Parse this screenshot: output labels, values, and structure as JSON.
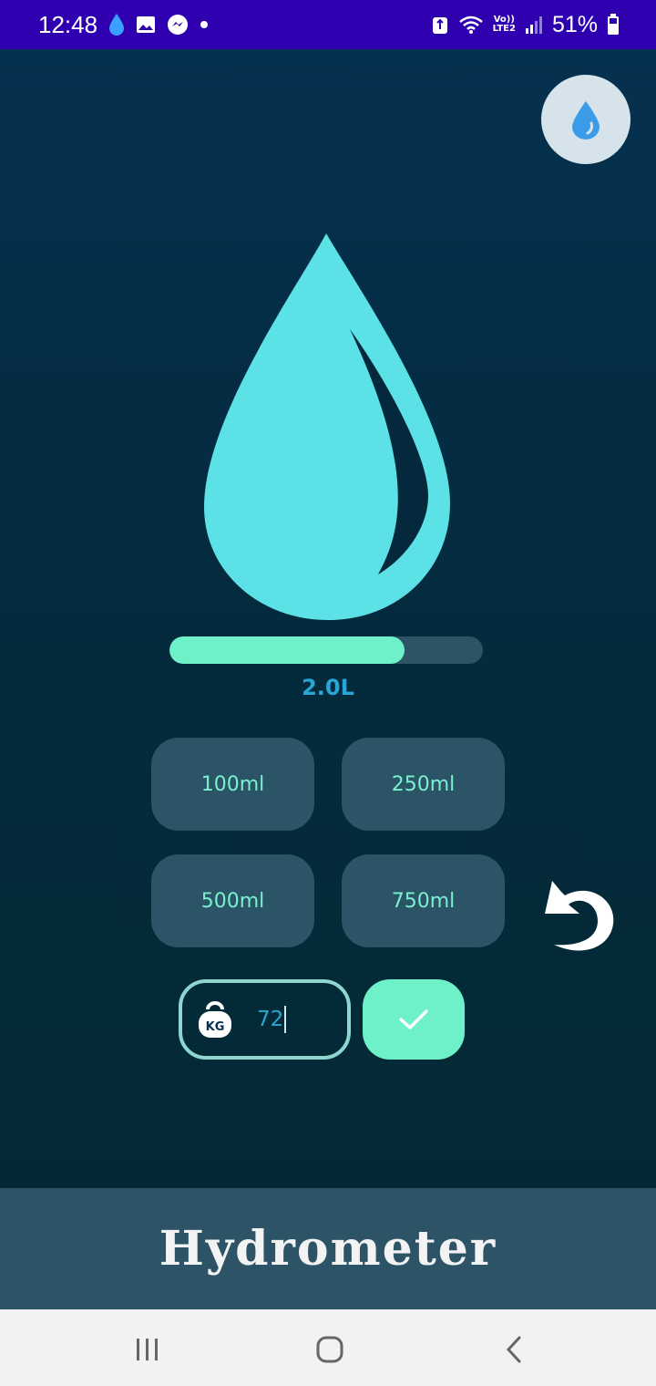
{
  "status_bar": {
    "time": "12:48",
    "battery_percent": "51%",
    "network_line1": "Vo))",
    "network_line2": "LTE2",
    "icons": [
      "water-drop-icon",
      "gallery-icon",
      "messenger-icon",
      "dot-icon",
      "recycle-icon",
      "wifi-icon",
      "signal-icon",
      "battery-icon"
    ]
  },
  "header": {
    "fab_icon": "water-drop-icon"
  },
  "hydration": {
    "drop_icon": "water-drop-icon",
    "progress_fraction": 0.75,
    "total_label": "2.0L"
  },
  "amounts": {
    "btn_100": "100ml",
    "btn_250": "250ml",
    "btn_500": "500ml",
    "btn_750": "750ml"
  },
  "weight": {
    "icon": "kg-weight-icon",
    "value": "72",
    "unit_icon_text": "KG"
  },
  "app_bar": {
    "title": "Hydrometer"
  },
  "colors": {
    "status_bar": "#2f00b0",
    "drop": "#5ce1e6",
    "accent": "#6ef0c8",
    "button_bg": "#2b5566",
    "value_text": "#2aa6d6"
  }
}
